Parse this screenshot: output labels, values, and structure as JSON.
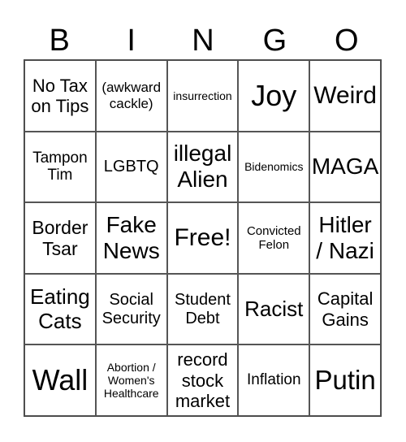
{
  "header": [
    "B",
    "I",
    "N",
    "G",
    "O"
  ],
  "cells": [
    {
      "text": "No Tax\non Tips",
      "size": 22
    },
    {
      "text": "(awkward\ncackle)",
      "size": 17
    },
    {
      "text": "insurrection",
      "size": 14
    },
    {
      "text": "Joy",
      "size": 36
    },
    {
      "text": "Weird",
      "size": 30
    },
    {
      "text": "Tampon\nTim",
      "size": 19
    },
    {
      "text": "LGBTQ",
      "size": 20
    },
    {
      "text": "illegal\nAlien",
      "size": 28
    },
    {
      "text": "Bidenomics",
      "size": 14
    },
    {
      "text": "MAGA",
      "size": 28
    },
    {
      "text": "Border\nTsar",
      "size": 23
    },
    {
      "text": "Fake\nNews",
      "size": 28
    },
    {
      "text": "Free!",
      "size": 30
    },
    {
      "text": "Convicted\nFelon",
      "size": 15
    },
    {
      "text": "Hitler\n/ Nazi",
      "size": 28
    },
    {
      "text": "Eating\nCats",
      "size": 26
    },
    {
      "text": "Social\nSecurity",
      "size": 20
    },
    {
      "text": "Student\nDebt",
      "size": 20
    },
    {
      "text": "Racist",
      "size": 26
    },
    {
      "text": "Capital\nGains",
      "size": 22
    },
    {
      "text": "Wall",
      "size": 36
    },
    {
      "text": "Abortion /\nWomen's\nHealthcare",
      "size": 14
    },
    {
      "text": "record\nstock\nmarket",
      "size": 22
    },
    {
      "text": "Inflation",
      "size": 19
    },
    {
      "text": "Putin",
      "size": 33
    }
  ]
}
